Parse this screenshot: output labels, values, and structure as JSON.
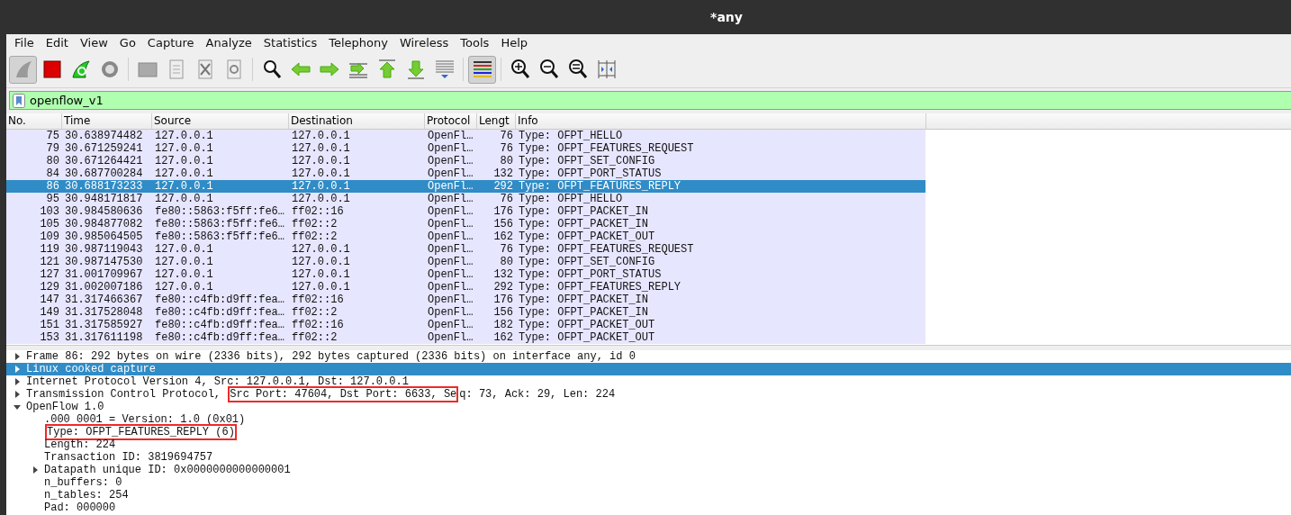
{
  "window": {
    "title": "*any"
  },
  "menu": [
    "File",
    "Edit",
    "View",
    "Go",
    "Capture",
    "Analyze",
    "Statistics",
    "Telephony",
    "Wireless",
    "Tools",
    "Help"
  ],
  "toolbar": [
    {
      "kind": "fin",
      "pressed": true
    },
    {
      "kind": "stop",
      "pressed": false
    },
    {
      "kind": "restart",
      "pressed": false
    },
    {
      "kind": "options",
      "pressed": false
    },
    {
      "kind": "sep"
    },
    {
      "kind": "open",
      "pressed": false
    },
    {
      "kind": "save",
      "pressed": false
    },
    {
      "kind": "close",
      "pressed": false
    },
    {
      "kind": "reload",
      "pressed": false
    },
    {
      "kind": "sep"
    },
    {
      "kind": "find",
      "pressed": false
    },
    {
      "kind": "back",
      "pressed": false
    },
    {
      "kind": "forward",
      "pressed": false
    },
    {
      "kind": "goto",
      "pressed": false
    },
    {
      "kind": "first",
      "pressed": false
    },
    {
      "kind": "last",
      "pressed": false
    },
    {
      "kind": "autoscroll",
      "pressed": false
    },
    {
      "kind": "sep"
    },
    {
      "kind": "colorize",
      "pressed": true
    },
    {
      "kind": "sep"
    },
    {
      "kind": "zoomin",
      "pressed": false
    },
    {
      "kind": "zoomout",
      "pressed": false
    },
    {
      "kind": "zoomreset",
      "pressed": false
    },
    {
      "kind": "resize",
      "pressed": false
    }
  ],
  "filter": {
    "value": "openflow_v1"
  },
  "packet_list": {
    "columns": [
      "No.",
      "Time",
      "Source",
      "Destination",
      "Protocol",
      "Lengt",
      "Info"
    ],
    "rows": [
      {
        "cells": [
          "75",
          "30.638974482",
          "127.0.0.1",
          "127.0.0.1",
          "OpenFl…",
          "76",
          "Type: OFPT_HELLO"
        ],
        "selected": false
      },
      {
        "cells": [
          "79",
          "30.671259241",
          "127.0.0.1",
          "127.0.0.1",
          "OpenFl…",
          "76",
          "Type: OFPT_FEATURES_REQUEST"
        ],
        "selected": false
      },
      {
        "cells": [
          "80",
          "30.671264421",
          "127.0.0.1",
          "127.0.0.1",
          "OpenFl…",
          "80",
          "Type: OFPT_SET_CONFIG"
        ],
        "selected": false
      },
      {
        "cells": [
          "84",
          "30.687700284",
          "127.0.0.1",
          "127.0.0.1",
          "OpenFl…",
          "132",
          "Type: OFPT_PORT_STATUS"
        ],
        "selected": false
      },
      {
        "cells": [
          "86",
          "30.688173233",
          "127.0.0.1",
          "127.0.0.1",
          "OpenFl…",
          "292",
          "Type: OFPT_FEATURES_REPLY"
        ],
        "selected": true
      },
      {
        "cells": [
          "95",
          "30.948171817",
          "127.0.0.1",
          "127.0.0.1",
          "OpenFl…",
          "76",
          "Type: OFPT_HELLO"
        ],
        "selected": false
      },
      {
        "cells": [
          "103",
          "30.984580636",
          "fe80::5863:f5ff:fe6…",
          "ff02::16",
          "OpenFl…",
          "176",
          "Type: OFPT_PACKET_IN"
        ],
        "selected": false
      },
      {
        "cells": [
          "105",
          "30.984877082",
          "fe80::5863:f5ff:fe6…",
          "ff02::2",
          "OpenFl…",
          "156",
          "Type: OFPT_PACKET_IN"
        ],
        "selected": false
      },
      {
        "cells": [
          "109",
          "30.985064505",
          "fe80::5863:f5ff:fe6…",
          "ff02::2",
          "OpenFl…",
          "162",
          "Type: OFPT_PACKET_OUT"
        ],
        "selected": false
      },
      {
        "cells": [
          "119",
          "30.987119043",
          "127.0.0.1",
          "127.0.0.1",
          "OpenFl…",
          "76",
          "Type: OFPT_FEATURES_REQUEST"
        ],
        "selected": false
      },
      {
        "cells": [
          "121",
          "30.987147530",
          "127.0.0.1",
          "127.0.0.1",
          "OpenFl…",
          "80",
          "Type: OFPT_SET_CONFIG"
        ],
        "selected": false
      },
      {
        "cells": [
          "127",
          "31.001709967",
          "127.0.0.1",
          "127.0.0.1",
          "OpenFl…",
          "132",
          "Type: OFPT_PORT_STATUS"
        ],
        "selected": false
      },
      {
        "cells": [
          "129",
          "31.002007186",
          "127.0.0.1",
          "127.0.0.1",
          "OpenFl…",
          "292",
          "Type: OFPT_FEATURES_REPLY"
        ],
        "selected": false
      },
      {
        "cells": [
          "147",
          "31.317466367",
          "fe80::c4fb:d9ff:fea…",
          "ff02::16",
          "OpenFl…",
          "176",
          "Type: OFPT_PACKET_IN"
        ],
        "selected": false
      },
      {
        "cells": [
          "149",
          "31.317528048",
          "fe80::c4fb:d9ff:fea…",
          "ff02::2",
          "OpenFl…",
          "156",
          "Type: OFPT_PACKET_IN"
        ],
        "selected": false
      },
      {
        "cells": [
          "151",
          "31.317585927",
          "fe80::c4fb:d9ff:fea…",
          "ff02::16",
          "OpenFl…",
          "182",
          "Type: OFPT_PACKET_OUT"
        ],
        "selected": false
      },
      {
        "cells": [
          "153",
          "31.317611198",
          "fe80::c4fb:d9ff:fea…",
          "ff02::2",
          "OpenFl…",
          "162",
          "Type: OFPT_PACKET_OUT"
        ],
        "selected": false
      }
    ]
  },
  "packet_details": [
    {
      "parts": [
        {
          "text": "Frame 86: 292 bytes on wire (2336 bits), 292 bytes captured (2336 bits) on interface any, id 0",
          "boxed": false
        }
      ],
      "expanded": false,
      "selected": false
    },
    {
      "parts": [
        {
          "text": "Linux cooked capture",
          "boxed": false
        }
      ],
      "expanded": false,
      "selected": true
    },
    {
      "parts": [
        {
          "text": "Internet Protocol Version 4, Src: 127.0.0.1, Dst: 127.0.0.1",
          "boxed": false
        }
      ],
      "expanded": false,
      "selected": false
    },
    {
      "parts": [
        {
          "text": "Transmission Control Protocol, ",
          "boxed": false
        },
        {
          "text": "Src Port: 47604, Dst Port: 6633, Se",
          "boxed": true
        },
        {
          "text": "q: 73, Ack: 29, Len: 224",
          "boxed": false
        }
      ],
      "expanded": false,
      "selected": false
    },
    {
      "parts": [
        {
          "text": "OpenFlow 1.0",
          "boxed": false
        }
      ],
      "expanded": true,
      "selected": false,
      "children": [
        {
          "parts": [
            {
              "text": ".000 0001 = Version: 1.0 (0x01)",
              "boxed": false
            }
          ],
          "selected": false
        },
        {
          "parts": [
            {
              "text": "Type: OFPT_FEATURES_REPLY (6)",
              "boxed": true
            }
          ],
          "selected": false
        },
        {
          "parts": [
            {
              "text": "Length: 224",
              "boxed": false
            }
          ],
          "selected": false
        },
        {
          "parts": [
            {
              "text": "Transaction ID: 3819694757",
              "boxed": false
            }
          ],
          "selected": false
        },
        {
          "parts": [
            {
              "text": "Datapath unique ID: 0x0000000000000001",
              "boxed": false
            }
          ],
          "expanded": false,
          "selected": false
        },
        {
          "parts": [
            {
              "text": "n_buffers: 0",
              "boxed": false
            }
          ],
          "selected": false
        },
        {
          "parts": [
            {
              "text": "n_tables: 254",
              "boxed": false
            }
          ],
          "selected": false
        },
        {
          "parts": [
            {
              "text": "Pad: 000000",
              "boxed": false
            }
          ],
          "selected": false
        }
      ]
    }
  ]
}
